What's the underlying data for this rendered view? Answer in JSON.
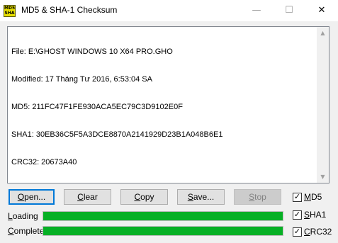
{
  "window": {
    "title": "MD5 & SHA-1 Checksum",
    "icon_text_top": "MD5",
    "icon_text_bottom": "SHA",
    "controls": {
      "minimize": "—",
      "maximize": "☐",
      "close": "✕"
    }
  },
  "output": {
    "lines": [
      "File: E:\\GHOST WINDOWS 10 X64 PRO.GHO",
      "Modified: 17 Tháng Tư 2016, 6:53:04 SA",
      "MD5: 211FC47F1FE930ACA5EC79C3D9102E0F",
      "SHA1: 30EB36C5F5A3DCE8870A2141929D23B1A048B6E1",
      "CRC32: 20673A40"
    ]
  },
  "buttons": {
    "open": {
      "first": "O",
      "rest": "pen..."
    },
    "clear": {
      "first": "C",
      "rest": "lear"
    },
    "copy": {
      "first": "C",
      "rest": "opy"
    },
    "save": {
      "first": "S",
      "rest": "ave..."
    },
    "stop": {
      "first": "S",
      "rest": "top"
    }
  },
  "checkboxes": {
    "md5": {
      "first": "M",
      "rest": "D5",
      "checked": true
    },
    "sha1": {
      "first": "S",
      "rest": "HA1",
      "checked": true
    },
    "crc32": {
      "first": "C",
      "rest": "RC32",
      "checked": true
    }
  },
  "progress": {
    "loading": {
      "first": "L",
      "rest": "oading",
      "value": 1.0
    },
    "complete": {
      "first": "C",
      "rest": "omplete",
      "value": 1.0
    }
  },
  "colors": {
    "progress_fill": "#06b025",
    "accent": "#0078d7"
  }
}
